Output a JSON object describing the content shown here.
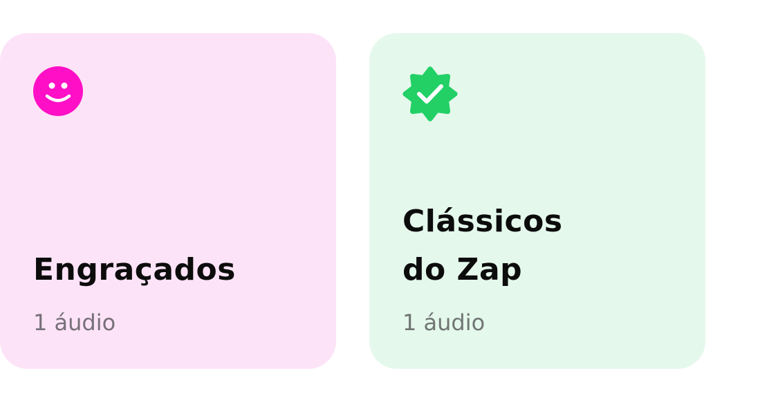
{
  "categories": [
    {
      "title_lines": [
        "Engraçados"
      ],
      "count": "1 áudio",
      "icon": "smiley-icon",
      "icon_color": "#ff0fc6",
      "background": "#fde3f7"
    },
    {
      "title_lines": [
        "Clássicos",
        "do Zap"
      ],
      "count": "1 áudio",
      "icon": "verified-badge-icon",
      "icon_color": "#22d066",
      "background": "#e5f8ec"
    }
  ]
}
